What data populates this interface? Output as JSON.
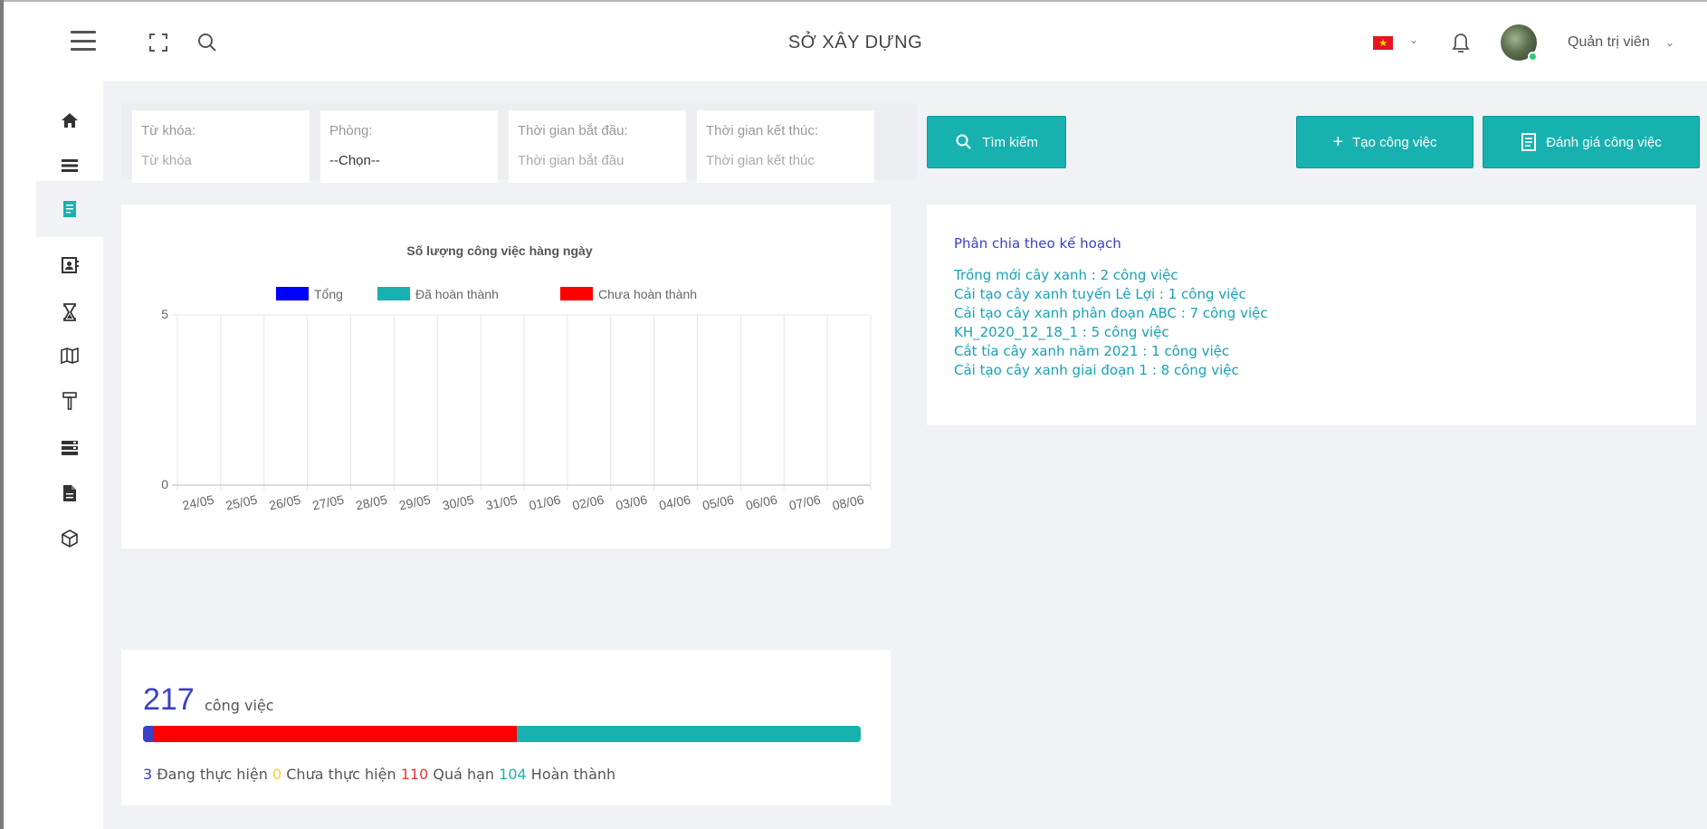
{
  "header": {
    "title": "SỞ XÂY DỰNG",
    "user_name": "Quản trị viên",
    "language_flag": "vietnam-flag",
    "icons": [
      "menu-icon",
      "fullscreen-icon",
      "search-icon",
      "bell-icon",
      "chevron-down-icon"
    ]
  },
  "sidebar": {
    "items": [
      {
        "icon": "home-icon",
        "active": false
      },
      {
        "icon": "list-icon",
        "active": false
      },
      {
        "icon": "clipboard-icon",
        "active": true
      },
      {
        "icon": "contact-card-icon",
        "active": false
      },
      {
        "icon": "hourglass-icon",
        "active": false
      },
      {
        "icon": "map-icon",
        "active": false
      },
      {
        "icon": "hammer-icon",
        "active": false
      },
      {
        "icon": "server-icon",
        "active": false
      },
      {
        "icon": "document-icon",
        "active": false
      },
      {
        "icon": "cube-icon",
        "active": false
      }
    ]
  },
  "filters": {
    "keyword": {
      "label": "Từ khóa:",
      "placeholder": "Từ khóa",
      "value": ""
    },
    "department": {
      "label": "Phòng:",
      "value": "--Chọn--"
    },
    "start_time": {
      "label": "Thời gian bắt đầu:",
      "placeholder": "Thời gian bắt đầu",
      "value": ""
    },
    "end_time": {
      "label": "Thời gian kết thúc:",
      "placeholder": "Thời gian kết thúc",
      "value": ""
    }
  },
  "buttons": {
    "search": "Tìm kiếm",
    "create_task": "Tạo công việc",
    "evaluate_task": "Đánh giá công việc"
  },
  "chart_data": {
    "type": "bar",
    "title": "Số lượng công việc hàng ngày",
    "xlabel": "",
    "ylabel": "",
    "categories": [
      "24/05",
      "25/05",
      "26/05",
      "27/05",
      "28/05",
      "29/05",
      "30/05",
      "31/05",
      "01/06",
      "02/06",
      "03/06",
      "04/06",
      "05/06",
      "06/06",
      "07/06",
      "08/06"
    ],
    "series": [
      {
        "name": "Tổng",
        "color": "#0000ff",
        "values": [
          0,
          0,
          0,
          0,
          0,
          0,
          0,
          0,
          0,
          0,
          0,
          0,
          0,
          0,
          0,
          0
        ]
      },
      {
        "name": "Đã hoàn thành",
        "color": "#17b2b0",
        "values": [
          0,
          0,
          0,
          0,
          0,
          0,
          0,
          0,
          0,
          0,
          0,
          0,
          0,
          0,
          0,
          0
        ]
      },
      {
        "name": "Chưa hoàn thành",
        "color": "#ff0000",
        "values": [
          0,
          0,
          0,
          0,
          0,
          0,
          0,
          0,
          0,
          0,
          0,
          0,
          0,
          0,
          0,
          0
        ]
      }
    ],
    "yticks": [
      "5",
      "0"
    ],
    "ylim": [
      0,
      5
    ],
    "grid": true,
    "legend_position": "top"
  },
  "plan": {
    "title": "Phân chia theo kế hoạch",
    "items": [
      "Trồng mới cây xanh : 2 công việc",
      "Cải tạo cây xanh tuyến Lê Lợi : 1 công việc",
      "Cải tạo cây xanh phân đoạn ABC : 7 công việc",
      "KH_2020_12_18_1 : 5 công việc",
      "Cắt tỉa cây xanh năm 2021 : 1 công việc",
      "Cải tạo cây xanh giai đoạn 1 : 8 công việc"
    ]
  },
  "summary": {
    "total": "217",
    "total_unit": "công việc",
    "in_progress": {
      "count": "3",
      "label": "Đang thực hiện",
      "color": "#3b40c9"
    },
    "not_started": {
      "count": "0",
      "label": "Chưa thực hiện",
      "color": "#f3d23c"
    },
    "overdue": {
      "count": "110",
      "label": "Quá hạn",
      "color": "#ff0000"
    },
    "completed": {
      "count": "104",
      "label": "Hoàn thành",
      "color": "#17b2b0"
    }
  }
}
